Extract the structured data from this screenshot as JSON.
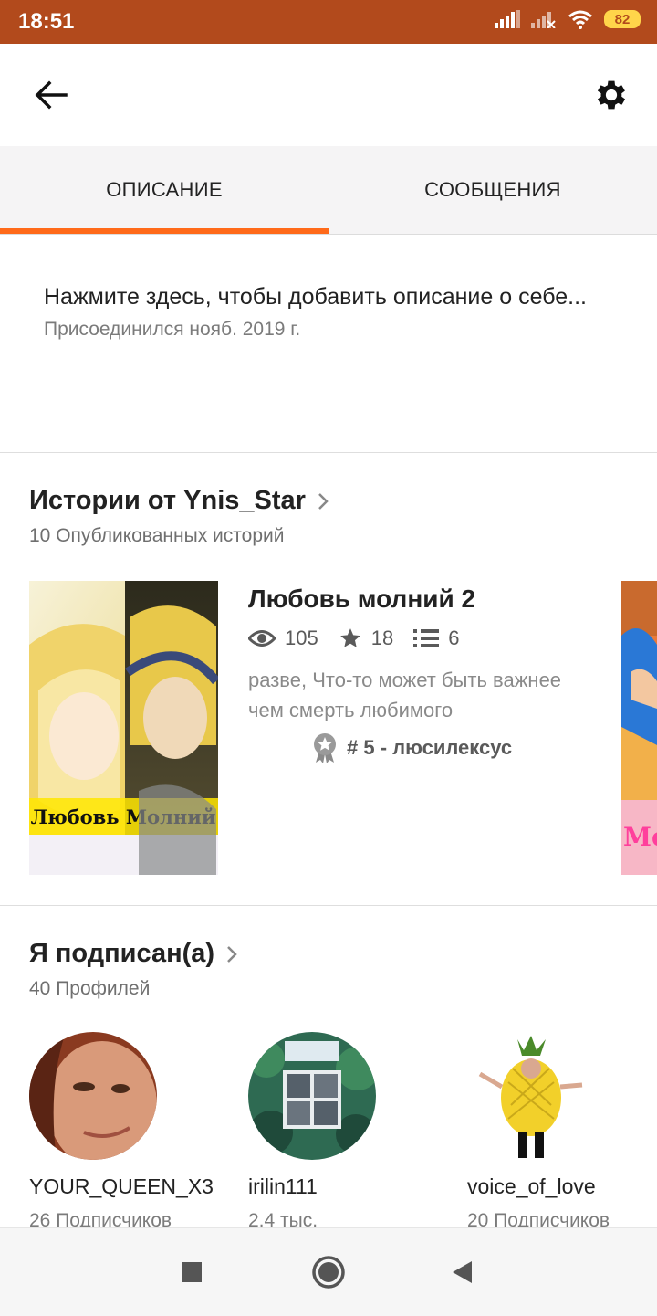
{
  "status_bar": {
    "time": "18:51",
    "battery": "82",
    "icons": [
      "signal-icon",
      "signal-icon",
      "wifi-icon",
      "battery-icon"
    ]
  },
  "app_bar": {
    "back_icon": "arrow-left-icon",
    "settings_icon": "gear-icon"
  },
  "tabs": [
    {
      "label": "ОПИСАНИЕ",
      "active": true
    },
    {
      "label": "СООБЩЕНИЯ",
      "active": false
    }
  ],
  "description": {
    "text": "Нажмите здесь, чтобы добавить описание о себе...",
    "joined": "Присоединился нояб. 2019 г."
  },
  "stories": {
    "title": "Истории от Ynis_Star",
    "subtitle": "10 Опубликованных историй",
    "items": [
      {
        "cover_text": "Любовь Молний",
        "title": "Любовь молний 2",
        "views": "105",
        "votes": "18",
        "parts": "6",
        "description": "разве, Что-то может быть важнее чем смерть любимого",
        "rank": "# 5 - люсилексус"
      }
    ],
    "next_cover_text": "Мо"
  },
  "following": {
    "title": "Я подписан(а)",
    "subtitle": "40 Профилей",
    "profiles": [
      {
        "name": "YOUR_QUEEN_X3",
        "followers": "26 Подписчиков"
      },
      {
        "name": "irilin111",
        "followers": "2,4 тыс."
      },
      {
        "name": "voice_of_love",
        "followers": "20 Подписчиков"
      }
    ]
  },
  "nav_bar": {
    "icons": [
      "recent-apps-icon",
      "home-icon",
      "back-triangle-icon"
    ]
  },
  "colors": {
    "status_bar": "#b24a1c",
    "accent": "#ff6a1a",
    "tab_bg": "#f5f4f5"
  }
}
